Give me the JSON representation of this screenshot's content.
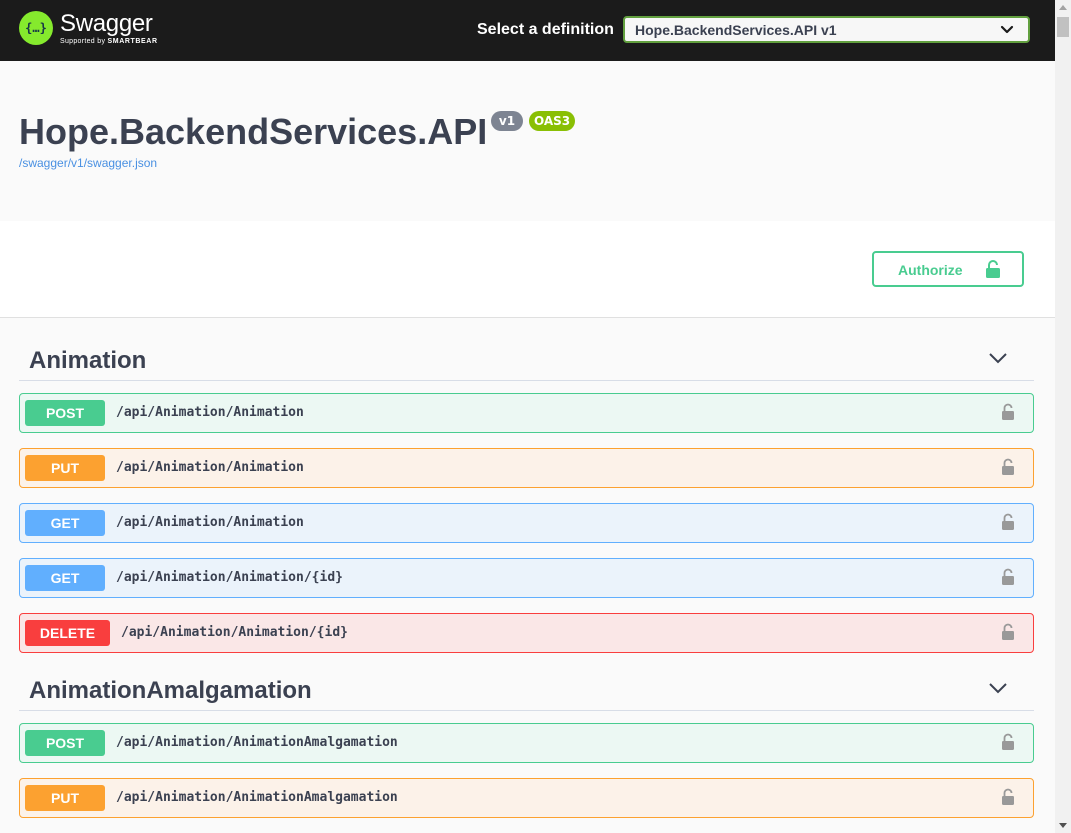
{
  "topbar": {
    "logo_glyph": "{…}",
    "logo_name": "Swagger",
    "logo_supported": "Supported by",
    "logo_brand": "SMARTBEAR",
    "select_label": "Select a definition",
    "select_value": "Hope.BackendServices.API v1"
  },
  "info": {
    "title": "Hope.BackendServices.API",
    "version_badge": "v1",
    "oas_badge": "OAS3",
    "spec_link": "/swagger/v1/swagger.json"
  },
  "auth": {
    "label": "Authorize"
  },
  "sections": [
    {
      "name": "Animation",
      "operations": [
        {
          "method": "POST",
          "path": "/api/Animation/Animation"
        },
        {
          "method": "PUT",
          "path": "/api/Animation/Animation"
        },
        {
          "method": "GET",
          "path": "/api/Animation/Animation"
        },
        {
          "method": "GET",
          "path": "/api/Animation/Animation/{id}"
        },
        {
          "method": "DELETE",
          "path": "/api/Animation/Animation/{id}"
        }
      ]
    },
    {
      "name": "AnimationAmalgamation",
      "operations": [
        {
          "method": "POST",
          "path": "/api/Animation/AnimationAmalgamation"
        },
        {
          "method": "PUT",
          "path": "/api/Animation/AnimationAmalgamation"
        }
      ]
    }
  ],
  "colors": {
    "post": "#49cc90",
    "put": "#fca130",
    "get": "#61affe",
    "delete": "#f93e3e",
    "topbar": "#1b1b1b",
    "logo": "#85ea2d"
  },
  "icons": [
    "chevron-down-icon",
    "lock-icon",
    "swagger-logo-icon",
    "scroll-up-icon",
    "scroll-down-icon"
  ]
}
